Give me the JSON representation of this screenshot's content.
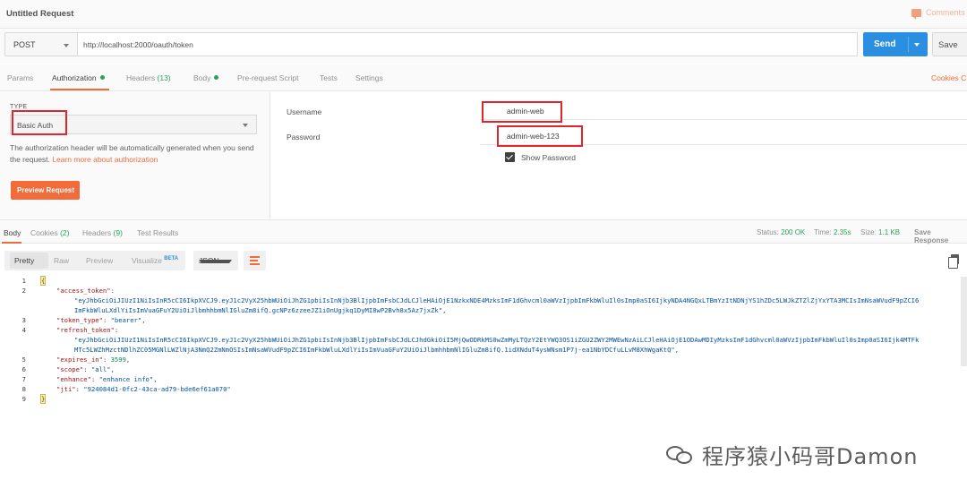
{
  "titlebar": {
    "title": "Untitled Request",
    "comments_label": "Comments"
  },
  "request": {
    "method": "POST",
    "url": "http://localhost:2000/oauth/token",
    "send_label": "Send",
    "save_label": "Save"
  },
  "request_tabs": [
    {
      "label": "Params"
    },
    {
      "label": "Authorization"
    },
    {
      "label": "Headers",
      "count": "(13)"
    },
    {
      "label": "Body"
    },
    {
      "label": "Pre-request Script"
    },
    {
      "label": "Tests"
    },
    {
      "label": "Settings"
    }
  ],
  "cookies_link": "Cookies",
  "cookies_link_tail": "C",
  "auth": {
    "type_label": "TYPE",
    "type_value": "Basic Auth",
    "help_text": "The authorization header will be automatically generated when you send the request.",
    "help_link": "Learn more about authorization",
    "preview_button": "Preview Request",
    "username_label": "Username",
    "username_value": "admin-web",
    "password_label": "Password",
    "password_value": "admin-web-123",
    "show_password_label": "Show Password"
  },
  "response_tabs": [
    {
      "label": "Body"
    },
    {
      "label": "Cookies",
      "count": "(2)"
    },
    {
      "label": "Headers",
      "count": "(9)"
    },
    {
      "label": "Test Results"
    }
  ],
  "response_status": {
    "status_label": "Status:",
    "status_value": "200 OK",
    "time_label": "Time:",
    "time_value": "2.35s",
    "size_label": "Size:",
    "size_value": "1.1 KB",
    "save_response": "Save Response"
  },
  "response_format": {
    "options": [
      "Pretty",
      "Raw",
      "Preview",
      "Visualize"
    ],
    "beta": "BETA",
    "selected": "Pretty",
    "lang": "JSON"
  },
  "code_lines": [
    {
      "n": "1",
      "text": "{"
    },
    {
      "n": "2",
      "key": "\"access_token\"",
      "rest": ":"
    },
    {
      "n": "",
      "str": "\"eyJhbGciOiJIUzI1NiIsInR5cCI6IkpXVCJ9.eyJ1c2VyX25hbWUiOiJhZG1pbiIsInNjb3BlIjpbImFsbCJdLCJleHAiOjE1NzkxNDE4MzksImF1dGhvcml0aWVzIjpbImFkbWluIl0sImp0aSI6IjkyNDA4NGQxLTBmYzItNDNjYS1hZDc5LWJkZTZlZjYxYTA3MCIsImNsaWVudF9pZCI6"
    },
    {
      "n": "",
      "str": "ImFkbWluLXdlYiIsImVuaGFuY2UiOiJlbmhhbmNlIGluZm8ifQ.gcNPz6zzeeJZ1iOnUgjkq1DyMI8wP2Bvh8x5Az7jxZk\","
    },
    {
      "n": "3",
      "key": "\"token_type\"",
      "rest": ": ",
      "str": "\"bearer\","
    },
    {
      "n": "4",
      "key": "\"refresh_token\"",
      "rest": ":"
    },
    {
      "n": "",
      "str": "\"eyJhbGciOiJIUzI1NiIsInR5cCI6IkpXVCJ9.eyJ1c2VyX25hbWUiOiJhZG1pbiIsInNjb3BlIjpbImFsbCJdLCJhdGkiOiI5MjQwODRkMS0wZmMyLTQzY2EtYWQ3OS1iZGU2ZWY2MWEwNzAiLCJleHAiOjE1ODAwMDIyMzksImF1dGhvcml0aWVzIjpbImFkbWluIl0sImp0aSI6Ijk4MTFk"
    },
    {
      "n": "",
      "str": "MTc5LWZhMzctNDlhZC05MGNlLWZlNjA3NmQ2ZmNmOSIsImNsaWVudF9pZCI6ImFkbWluLXdlYiIsImVuaGFuY2UiOiJlbmhhbmNlIGluZm8ifQ.1idXNduT4ysWNsm1P7j-ea1NbYDCfuLLvM8XhWgaKtQ\","
    },
    {
      "n": "5",
      "key": "\"expires_in\"",
      "rest": ": ",
      "num": "3599",
      "tail": ","
    },
    {
      "n": "6",
      "key": "\"scope\"",
      "rest": ": ",
      "str": "\"all\","
    },
    {
      "n": "7",
      "key": "\"enhance\"",
      "rest": ": ",
      "str": "\"enhance info\","
    },
    {
      "n": "8",
      "key": "\"jti\"",
      "rest": ": ",
      "str": "\"924084d1-0fc2-43ca-ad79-bde6ef61a070\""
    },
    {
      "n": "9",
      "text": "}"
    }
  ],
  "watermark": "程序猿小码哥Damon"
}
